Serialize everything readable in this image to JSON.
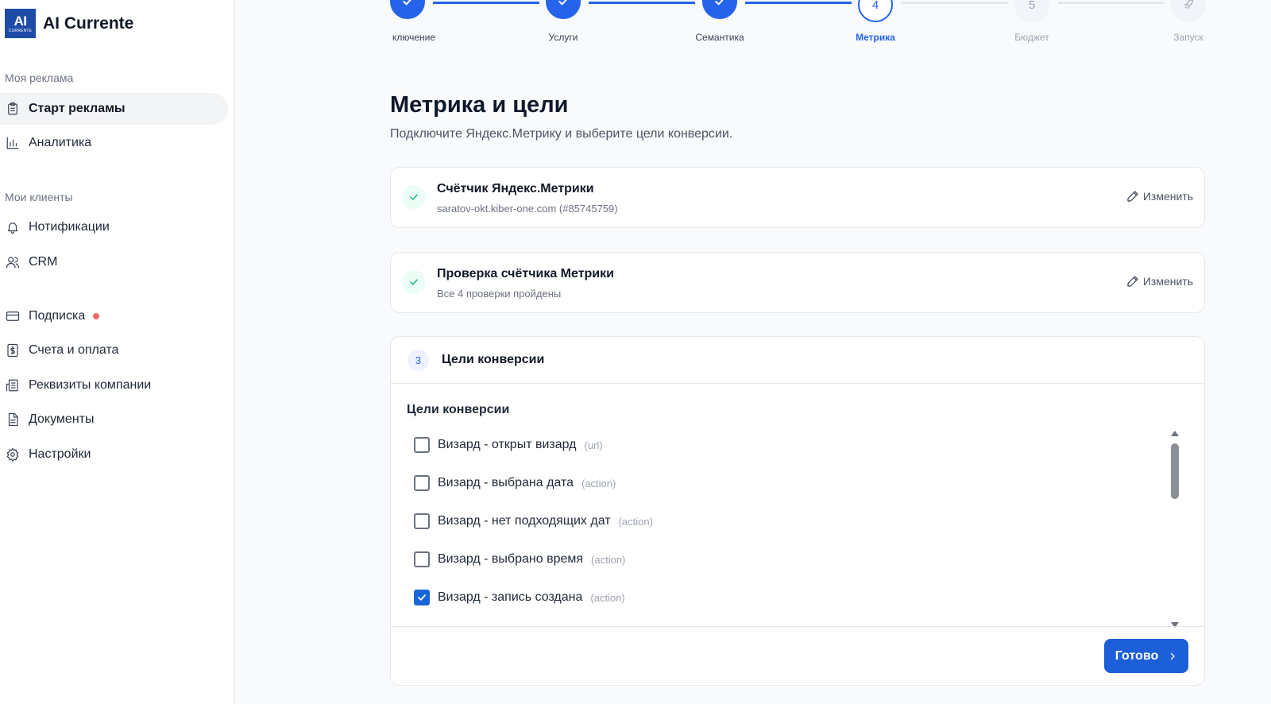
{
  "app": {
    "logo_text": "AI",
    "logo_subtext": "CURRENTE",
    "title": "AI Currente"
  },
  "sidebar": {
    "section1": "Моя реклама",
    "items1": [
      {
        "label": "Старт рекламы",
        "icon": "clipboard-icon",
        "active": true
      },
      {
        "label": "Аналитика",
        "icon": "bar-chart-icon"
      }
    ],
    "section2": "Мои клиенты",
    "items2": [
      {
        "label": "Нотификации",
        "icon": "bell-icon"
      },
      {
        "label": "CRM",
        "icon": "users-icon"
      }
    ],
    "items3": [
      {
        "label": "Подписка",
        "icon": "card-icon",
        "dot": true
      },
      {
        "label": "Счета и оплата",
        "icon": "dollar-doc-icon"
      },
      {
        "label": "Реквизиты компании",
        "icon": "building-icon"
      },
      {
        "label": "Документы",
        "icon": "document-icon"
      },
      {
        "label": "Настройки",
        "icon": "gear-icon"
      }
    ]
  },
  "stepper": {
    "steps": [
      {
        "label": "ключение",
        "state": "done"
      },
      {
        "label": "Услуги",
        "state": "done"
      },
      {
        "label": "Семантика",
        "state": "done"
      },
      {
        "label": "Метрика",
        "state": "current",
        "number": "4"
      },
      {
        "label": "Бюджет",
        "state": "todo",
        "number": "5"
      },
      {
        "label": "Запуск",
        "state": "todo"
      }
    ]
  },
  "main": {
    "title": "Метрика и цели",
    "subtitle": "Подключите Яндекс.Метрику и выберите цели конверсии."
  },
  "counter_card": {
    "title": "Счётчик Яндекс.Метрики",
    "subtitle": "saratov-okt.kiber-one.com (#85745759)",
    "edit_label": "Изменить"
  },
  "check_card": {
    "title": "Проверка счётчика Метрики",
    "subtitle": "Все 4 проверки пройдены",
    "edit_label": "Изменить"
  },
  "goals_card": {
    "number": "3",
    "header": "Цели конверсии",
    "label": "Цели конверсии",
    "goals": [
      {
        "name": "Визард - открыт визард",
        "type": "(url)",
        "checked": false
      },
      {
        "name": "Визард - выбрана дата",
        "type": "(action)",
        "checked": false
      },
      {
        "name": "Визард - нет подходящих дат",
        "type": "(action)",
        "checked": false
      },
      {
        "name": "Визард - выбрано время",
        "type": "(action)",
        "checked": false
      },
      {
        "name": "Визард - запись создана",
        "type": "(action)",
        "checked": true
      }
    ],
    "done_label": "Готово"
  },
  "colors": {
    "accent": "#2563eb",
    "success": "#10b981",
    "notify_dot": "#ef6b6b"
  }
}
